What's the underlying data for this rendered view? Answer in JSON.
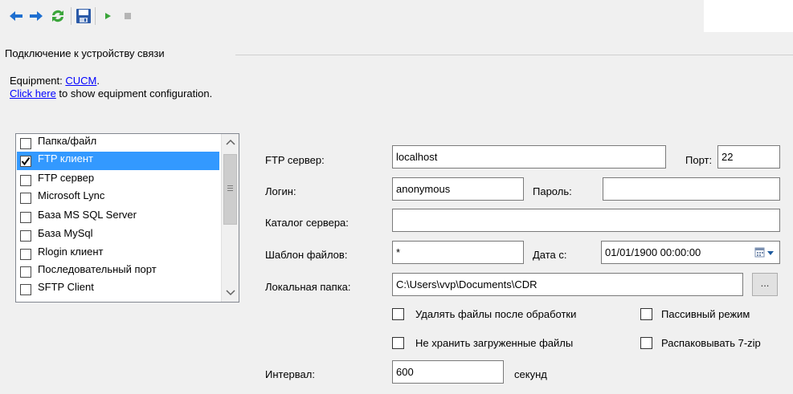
{
  "toolbar": {
    "buttons": [
      {
        "name": "back-button",
        "icon": "arrow-left-icon"
      },
      {
        "name": "forward-button",
        "icon": "arrow-right-icon"
      },
      {
        "name": "refresh-button",
        "icon": "refresh-icon"
      },
      {
        "name": "save-button",
        "icon": "floppy-disk-icon"
      },
      {
        "name": "run-button",
        "icon": "play-icon"
      },
      {
        "name": "stop-button",
        "icon": "stop-icon"
      }
    ]
  },
  "group": {
    "title": "Подключение к устройству связи"
  },
  "equipment": {
    "prefix": "Equipment: ",
    "name": "CUCM",
    "suffix": ".",
    "link_text": "Click here",
    "link_suffix": " to show equipment configuration."
  },
  "source_list": {
    "items": [
      {
        "label": "Папка/файл",
        "checked": false,
        "selected": false
      },
      {
        "label": "FTP клиент",
        "checked": true,
        "selected": true
      },
      {
        "label": "FTP сервер",
        "checked": false,
        "selected": false
      },
      {
        "label": "Microsoft Lync",
        "checked": false,
        "selected": false
      },
      {
        "label": "База MS SQL Server",
        "checked": false,
        "selected": false
      },
      {
        "label": "База MySql",
        "checked": false,
        "selected": false
      },
      {
        "label": "Rlogin клиент",
        "checked": false,
        "selected": false
      },
      {
        "label": "Последовательный порт",
        "checked": false,
        "selected": false
      },
      {
        "label": "SFTP Client",
        "checked": false,
        "selected": false
      }
    ]
  },
  "form": {
    "ftp_server_label": "FTP сервер:",
    "ftp_server_value": "localhost",
    "port_label": "Порт:",
    "port_value": "22",
    "login_label": "Логин:",
    "login_value": "anonymous",
    "password_label": "Пароль:",
    "password_value": "",
    "catalog_label": "Каталог сервера:",
    "catalog_value": "",
    "template_label": "Шаблон файлов:",
    "template_value": "*",
    "date_label": "Дата с:",
    "date_value": "01/01/1900 00:00:00",
    "local_folder_label": "Локальная папка:",
    "local_folder_value": "C:\\Users\\vvp\\Documents\\CDR",
    "browse_label": "...",
    "delete_after_label": "Удалять файлы после обработки",
    "passive_label": "Пассивный режим",
    "no_store_label": "Не хранить загруженные файлы",
    "unpack_label": "Распаковывать 7-zip",
    "interval_label": "Интервал:",
    "interval_value": "600",
    "interval_unit": "секунд"
  },
  "colors": {
    "selection": "#3399ff",
    "link": "#0000ff",
    "panel": "#f0f0f0"
  }
}
